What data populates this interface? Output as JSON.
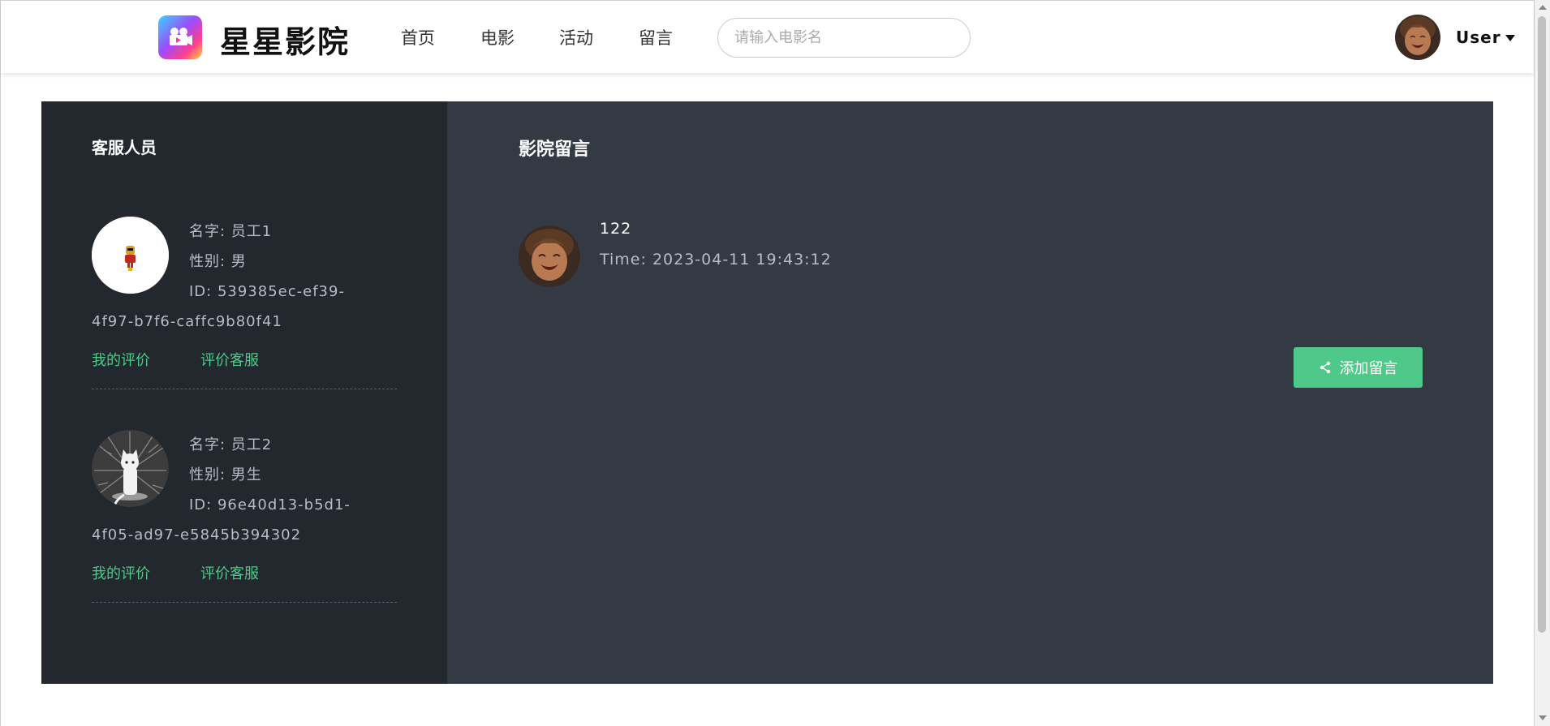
{
  "header": {
    "brand": "星星影院",
    "nav": [
      "首页",
      "电影",
      "活动",
      "留言"
    ],
    "search_placeholder": "请输入电影名",
    "user_name": "User"
  },
  "staff_panel": {
    "title": "客服人员",
    "members": [
      {
        "name": "名字: 员工1",
        "gender": "性别: 男",
        "id_line1": "ID: 539385ec-ef39-",
        "id_line2": "4f97-b7f6-caffc9b80f41",
        "my_review": "我的评价",
        "rate": "评价客服"
      },
      {
        "name": "名字: 员工2",
        "gender": "性别: 男生",
        "id_line1": "ID: 96e40d13-b5d1-",
        "id_line2": "4f05-ad97-e5845b394302",
        "my_review": "我的评价",
        "rate": "评价客服"
      }
    ]
  },
  "messages_panel": {
    "title": "影院留言",
    "messages": [
      {
        "text": "122",
        "time": "Time: 2023-04-11 19:43:12"
      }
    ],
    "add_button": "添加留言"
  },
  "colors": {
    "accent": "#4fc98a",
    "left_bg": "#23272e",
    "right_bg": "#343a43"
  },
  "icons": [
    "film-camera-logo-icon",
    "share-icon",
    "chevron-down-icon"
  ]
}
